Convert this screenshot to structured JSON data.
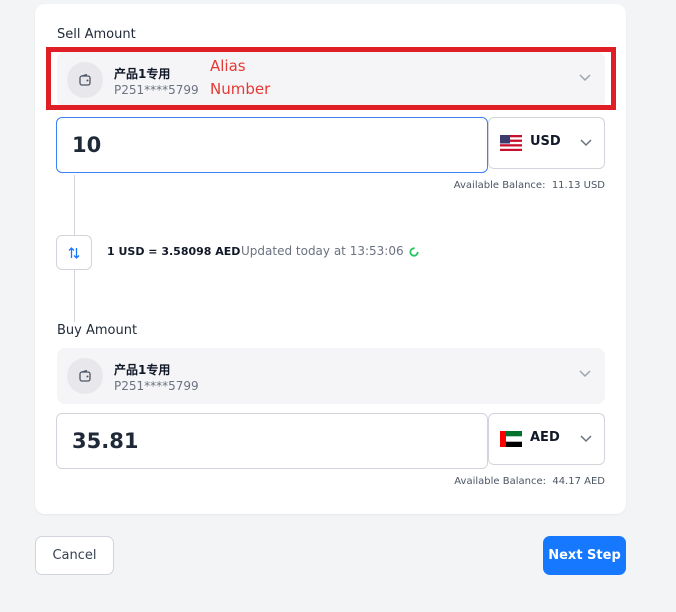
{
  "sell": {
    "label": "Sell Amount",
    "account_name": "产品1专用",
    "account_number": "P251****5799",
    "annotation_alias": "Alias",
    "annotation_number": "Number",
    "amount": "10",
    "currency": "USD",
    "currency_flag_icon": "us-flag-icon",
    "balance_label": "Available Balance:",
    "balance_value": "11.13 USD"
  },
  "rate": {
    "text": "1 USD = 3.58098 AED",
    "updated": "Updated today at 13:53:06"
  },
  "buy": {
    "label": "Buy Amount",
    "account_name": "产品1专用",
    "account_number": "P251****5799",
    "amount": "35.81",
    "currency": "AED",
    "currency_flag_icon": "uae-flag-icon",
    "balance_label": "Available Balance:",
    "balance_value": "44.17 AED"
  },
  "actions": {
    "cancel": "Cancel",
    "next": "Next Step"
  },
  "colors": {
    "primary": "#1677ff",
    "highlight": "#e01e26",
    "focus": "#3b82f6"
  }
}
